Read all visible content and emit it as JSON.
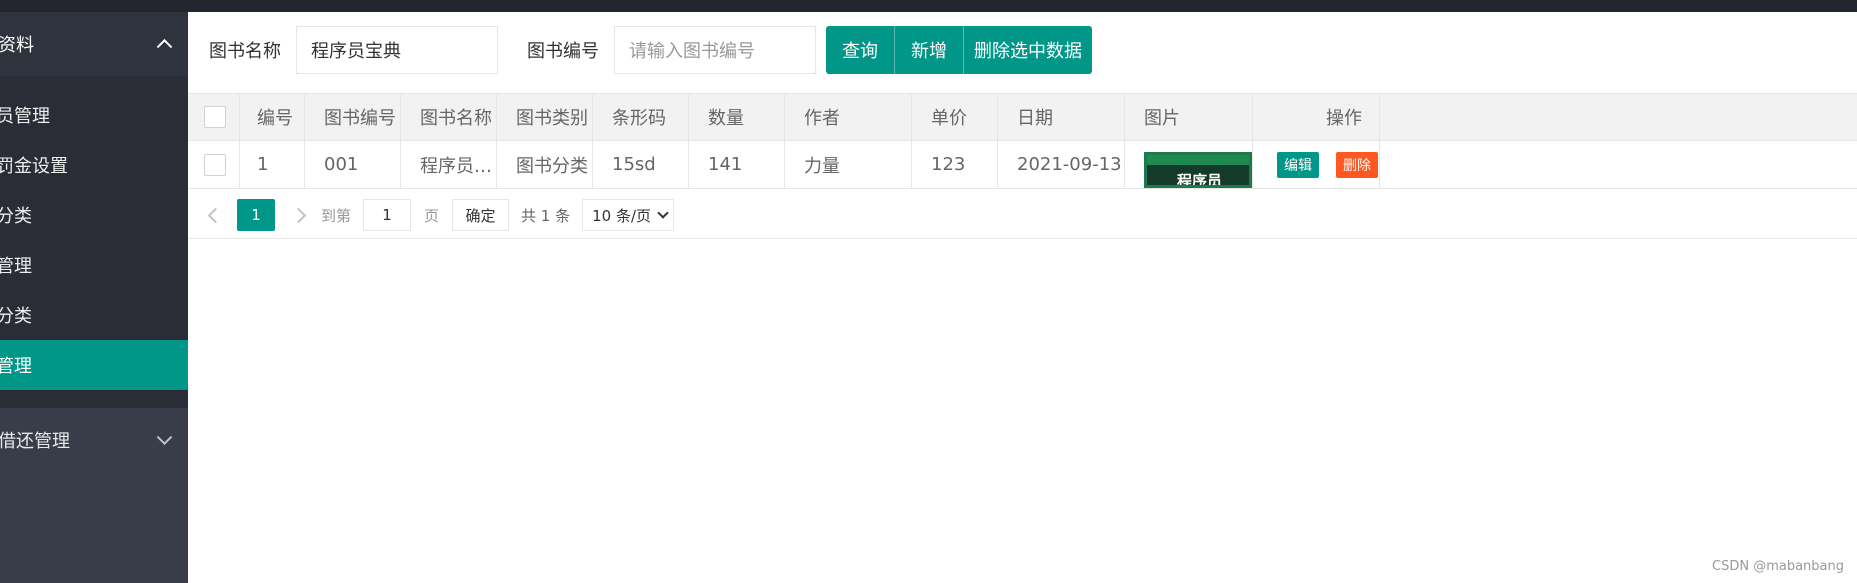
{
  "sidebar": {
    "group1_label": "资料",
    "items": [
      {
        "label": "员管理"
      },
      {
        "label": "罚金设置"
      },
      {
        "label": "分类"
      },
      {
        "label": "管理"
      },
      {
        "label": "分类"
      },
      {
        "label": "管理",
        "active": true
      }
    ],
    "group2_label": "借还管理"
  },
  "search": {
    "name_label": "图书名称",
    "name_value": "程序员宝典",
    "code_label": "图书编号",
    "code_placeholder": "请输入图书编号",
    "query_btn": "查询",
    "add_btn": "新增",
    "delete_btn": "删除选中数据"
  },
  "table": {
    "headers": [
      "编号",
      "图书编号",
      "图书名称",
      "图书类别",
      "条形码",
      "数量",
      "作者",
      "单价",
      "日期",
      "图片",
      "操作"
    ],
    "rows": [
      {
        "id": "1",
        "book_no": "001",
        "name": "程序员…",
        "category": "图书分类",
        "barcode": "15sd",
        "qty": "141",
        "author": "力量",
        "price": "123",
        "date": "2021-09-13 …",
        "image_text": "程序员",
        "edit": "编辑",
        "delete": "删除"
      }
    ]
  },
  "pager": {
    "current": "1",
    "goto_label": "到第",
    "goto_value": "1",
    "page_label": "页",
    "confirm": "确定",
    "total": "共 1 条",
    "per_page": "10 条/页"
  },
  "watermark": "CSDN @mabanbang",
  "colors": {
    "primary": "#009688",
    "danger": "#ff5722",
    "sidebar": "#393d49"
  }
}
